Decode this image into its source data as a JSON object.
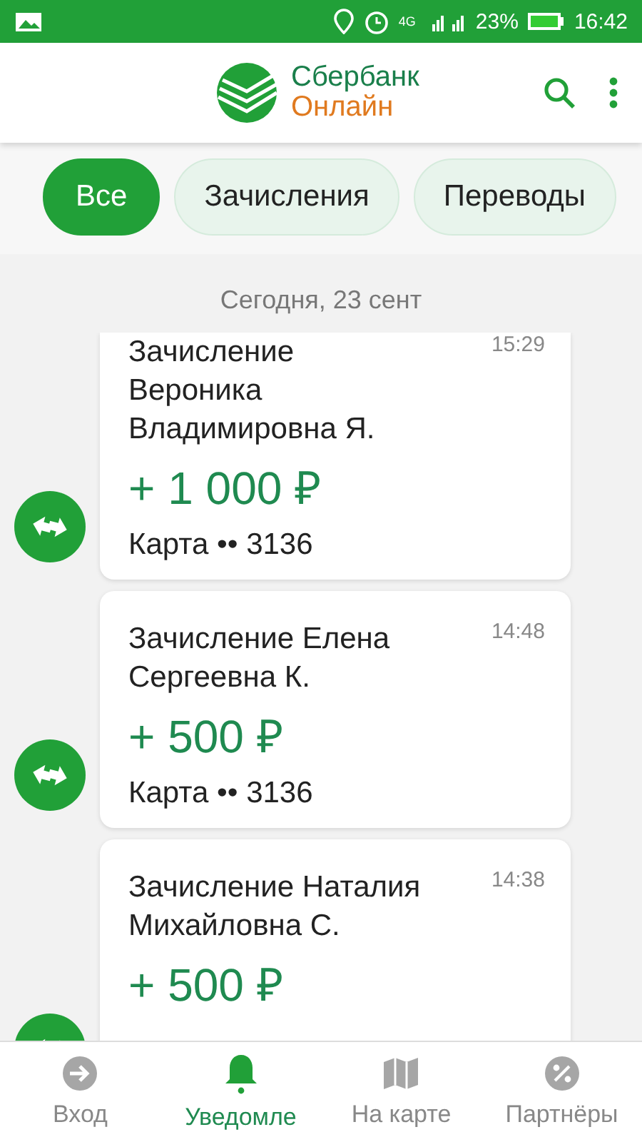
{
  "status_bar": {
    "network": "4G",
    "battery": "23%",
    "time": "16:42"
  },
  "header": {
    "logo_top": "Сбербанк",
    "logo_bottom": "Онлайн"
  },
  "filters": [
    {
      "label": "Все",
      "selected": true
    },
    {
      "label": "Зачисления",
      "selected": false
    },
    {
      "label": "Переводы",
      "selected": false
    }
  ],
  "date": "Сегодня, 23 сент",
  "notifications": [
    {
      "title": "Зачисление Вероника Владимировна Я.",
      "time": "15:29",
      "amount": "+ 1 000 ₽",
      "card": "Карта •• 3136"
    },
    {
      "title": "Зачисление Елена Сергеевна К.",
      "time": "14:48",
      "amount": "+ 500 ₽",
      "card": "Карта •• 3136"
    },
    {
      "title": "Зачисление Наталия Михайловна С.",
      "time": "14:38",
      "amount": "+ 500 ₽"
    }
  ],
  "nav": [
    {
      "label": "Вход",
      "selected": false
    },
    {
      "label": "Уведомле",
      "selected": true
    },
    {
      "label": "На карте",
      "selected": false
    },
    {
      "label": "Партнёры",
      "selected": false
    }
  ]
}
